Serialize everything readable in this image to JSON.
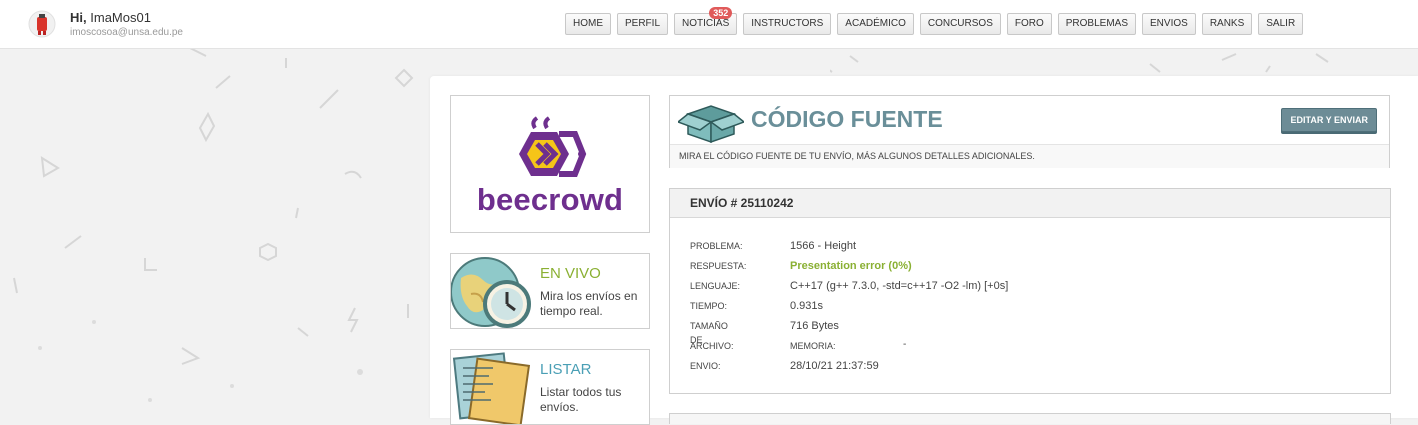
{
  "header": {
    "greeting_prefix": "Hi,",
    "username": "ImaMos01",
    "email": "imoscosoa@unsa.edu.pe"
  },
  "menu": [
    {
      "label": "HOME"
    },
    {
      "label": "PERFIL"
    },
    {
      "label": "NOTICIAS",
      "badge": "352"
    },
    {
      "label": "INSTRUCTORS"
    },
    {
      "label": "ACADÉMICO"
    },
    {
      "label": "CONCURSOS"
    },
    {
      "label": "FORO"
    },
    {
      "label": "PROBLEMAS"
    },
    {
      "label": "ENVIOS"
    },
    {
      "label": "RANKS"
    },
    {
      "label": "SALIR"
    }
  ],
  "sidebar": {
    "logo_text": "beecrowd",
    "live": {
      "title": "EN VIVO",
      "description": "Mira los envíos en tiempo real.",
      "color": "#8ab033"
    },
    "list": {
      "title": "LISTAR",
      "description": "Listar todos tus envíos.",
      "color": "#4a9fb5"
    }
  },
  "code_panel": {
    "title": "CÓDIGO FUENTE",
    "button": "EDITAR Y ENVIAR",
    "subtitle": "MIRA EL CÓDIGO FUENTE DE TU ENVÍO, MÁS ALGUNOS DETALLES ADICIONALES."
  },
  "submission": {
    "header": "ENVÍO # 25110242",
    "rows": {
      "problem": {
        "label": "PROBLEMA:",
        "value": "1566 - Height"
      },
      "answer": {
        "label": "RESPUESTA:",
        "value": "Presentation error (0%)"
      },
      "language": {
        "label": "LENGUAJE:",
        "value": "C++17 (g++ 7.3.0, -std=c++17 -O2 -lm) [+0s]"
      },
      "time": {
        "label": "TIEMPO:",
        "value": "0.931s"
      },
      "size": {
        "label": "TAMAÑO DE",
        "value": "716 Bytes"
      },
      "file": {
        "label": "ARCHIVO:",
        "value": "MEMORIA:",
        "memory_value": "-"
      },
      "sent": {
        "label": "ENVIO:",
        "value": "28/10/21 21:37:59"
      }
    }
  },
  "colors": {
    "accent": "#6a8f99",
    "ok": "#8ab033",
    "brand": "#6e2f8e",
    "brand_yellow": "#f5c518"
  }
}
